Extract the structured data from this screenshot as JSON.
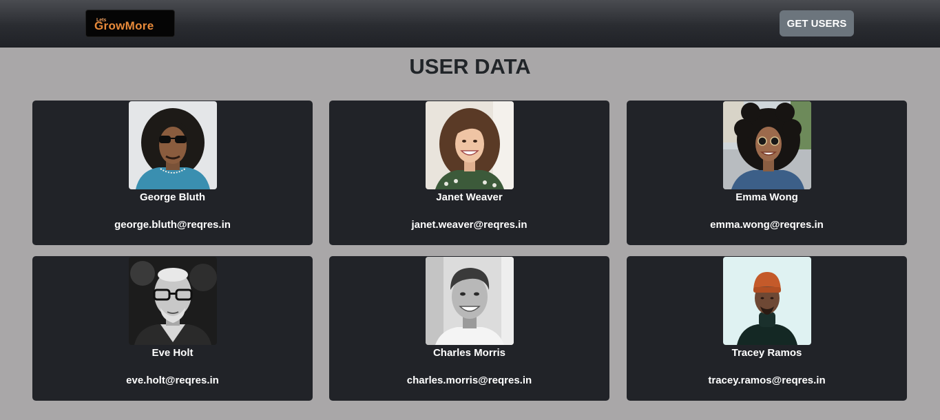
{
  "navbar": {
    "logo_small": "Lets",
    "logo_text": "GrowMore",
    "get_users_label": "GET USERS"
  },
  "page": {
    "title": "USER DATA"
  },
  "users": [
    {
      "name": "George Bluth",
      "email": "george.bluth@reqres.in"
    },
    {
      "name": "Janet Weaver",
      "email": "janet.weaver@reqres.in"
    },
    {
      "name": "Emma Wong",
      "email": "emma.wong@reqres.in"
    },
    {
      "name": "Eve Holt",
      "email": "eve.holt@reqres.in"
    },
    {
      "name": "Charles Morris",
      "email": "charles.morris@reqres.in"
    },
    {
      "name": "Tracey Ramos",
      "email": "tracey.ramos@reqres.in"
    }
  ],
  "colors": {
    "page_bg": "#a9a7a8",
    "card_bg": "#212328",
    "button_bg": "#6c757d",
    "logo_accent": "#e88a3a"
  }
}
